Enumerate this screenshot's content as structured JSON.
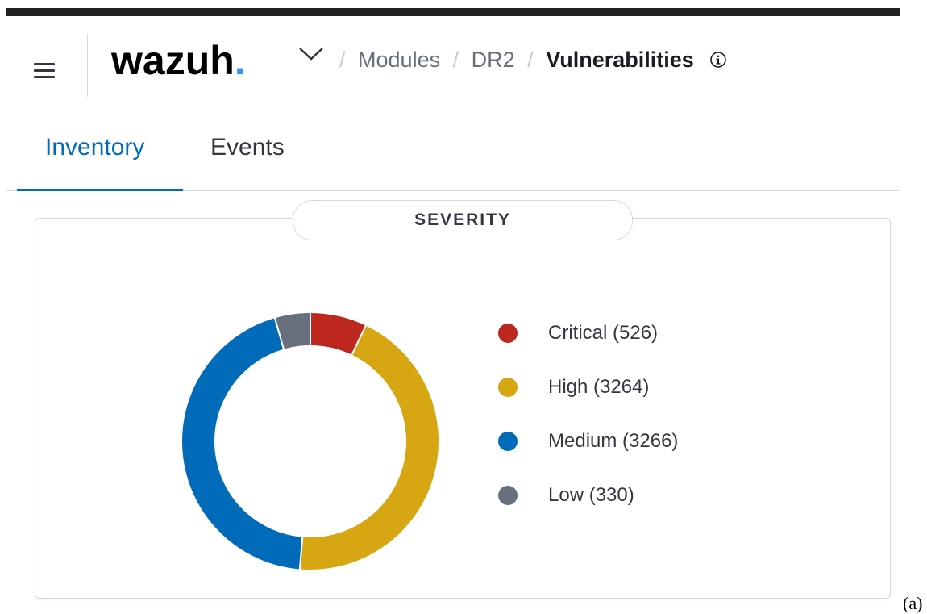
{
  "header": {
    "logo_text": "wazuh",
    "logo_dot": ".",
    "breadcrumbs": [
      "Modules",
      "DR2"
    ],
    "current_page": "Vulnerabilities",
    "separator": "/"
  },
  "tabs": [
    {
      "label": "Inventory",
      "active": true
    },
    {
      "label": "Events",
      "active": false
    }
  ],
  "panel": {
    "title": "SEVERITY"
  },
  "chart_data": {
    "type": "pie",
    "donut": true,
    "title": "SEVERITY",
    "categories": [
      "Critical",
      "High",
      "Medium",
      "Low"
    ],
    "values": [
      526,
      3264,
      3266,
      330
    ],
    "colors": [
      "#bd271e",
      "#d6a613",
      "#006bb8",
      "#69707d"
    ],
    "legend": [
      "Critical (526)",
      "High (3264)",
      "Medium (3266)",
      "Low (330)"
    ],
    "legend_position": "right"
  },
  "figure_label": "(a)",
  "colors": {
    "accent": "#006bb8",
    "logo_dot": "#3595f9"
  }
}
